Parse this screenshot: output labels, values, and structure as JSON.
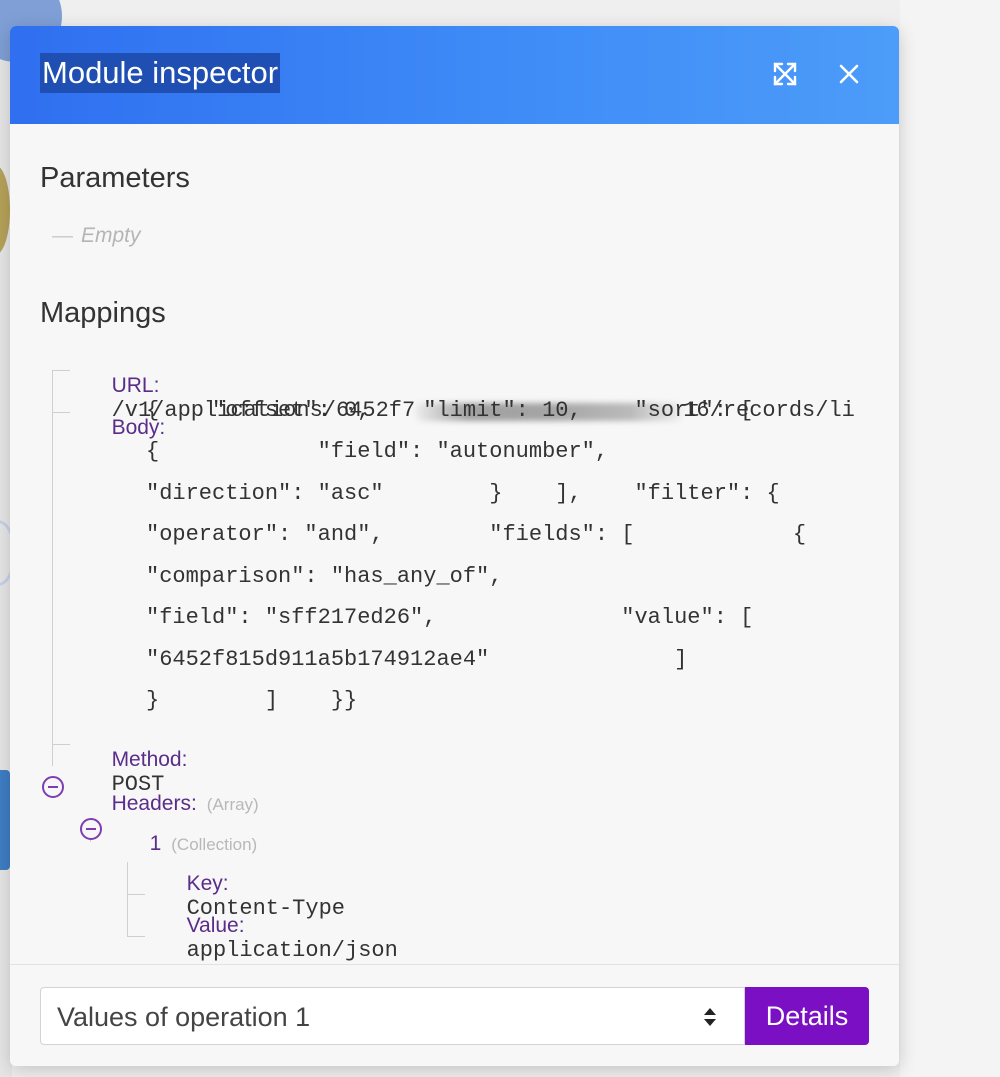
{
  "dialog": {
    "title": "Module inspector",
    "expand_icon": "expand-arrows-icon",
    "close_icon": "close-icon"
  },
  "parameters": {
    "title": "Parameters",
    "empty_label": "Empty"
  },
  "mappings": {
    "title": "Mappings",
    "url": {
      "key": "URL:",
      "value_prefix": "/v1/applications/6452f7",
      "value_suffix": "16/records/li"
    },
    "body": {
      "key": "Body:",
      "lines": [
        "{    \"offset\": 0,    \"limit\": 10,    \"sort\": [",
        "{            \"field\": \"autonumber\",",
        "\"direction\": \"asc\"        }    ],    \"filter\": {",
        "\"operator\": \"and\",        \"fields\": [            {",
        "\"comparison\": \"has_any_of\",",
        "\"field\": \"sff217ed26\",              \"value\": [",
        "\"6452f815d911a5b174912ae4\"              ]",
        "}        ]    }}"
      ]
    },
    "method": {
      "key": "Method:",
      "value": "POST"
    },
    "headers": {
      "key": "Headers:",
      "type": "(Array)",
      "items": [
        {
          "index": "1",
          "type": "(Collection)",
          "key_label": "Key:",
          "key_value": "Content-Type",
          "value_label": "Value:",
          "value_value": "application/json"
        }
      ]
    }
  },
  "footer": {
    "select_value": "Values of operation 1",
    "details_label": "Details"
  },
  "colors": {
    "header_gradient_start": "#2f6ff0",
    "header_gradient_end": "#4c9cf9",
    "key_purple": "#5a2d8a",
    "details_button": "#7a0fc4"
  }
}
